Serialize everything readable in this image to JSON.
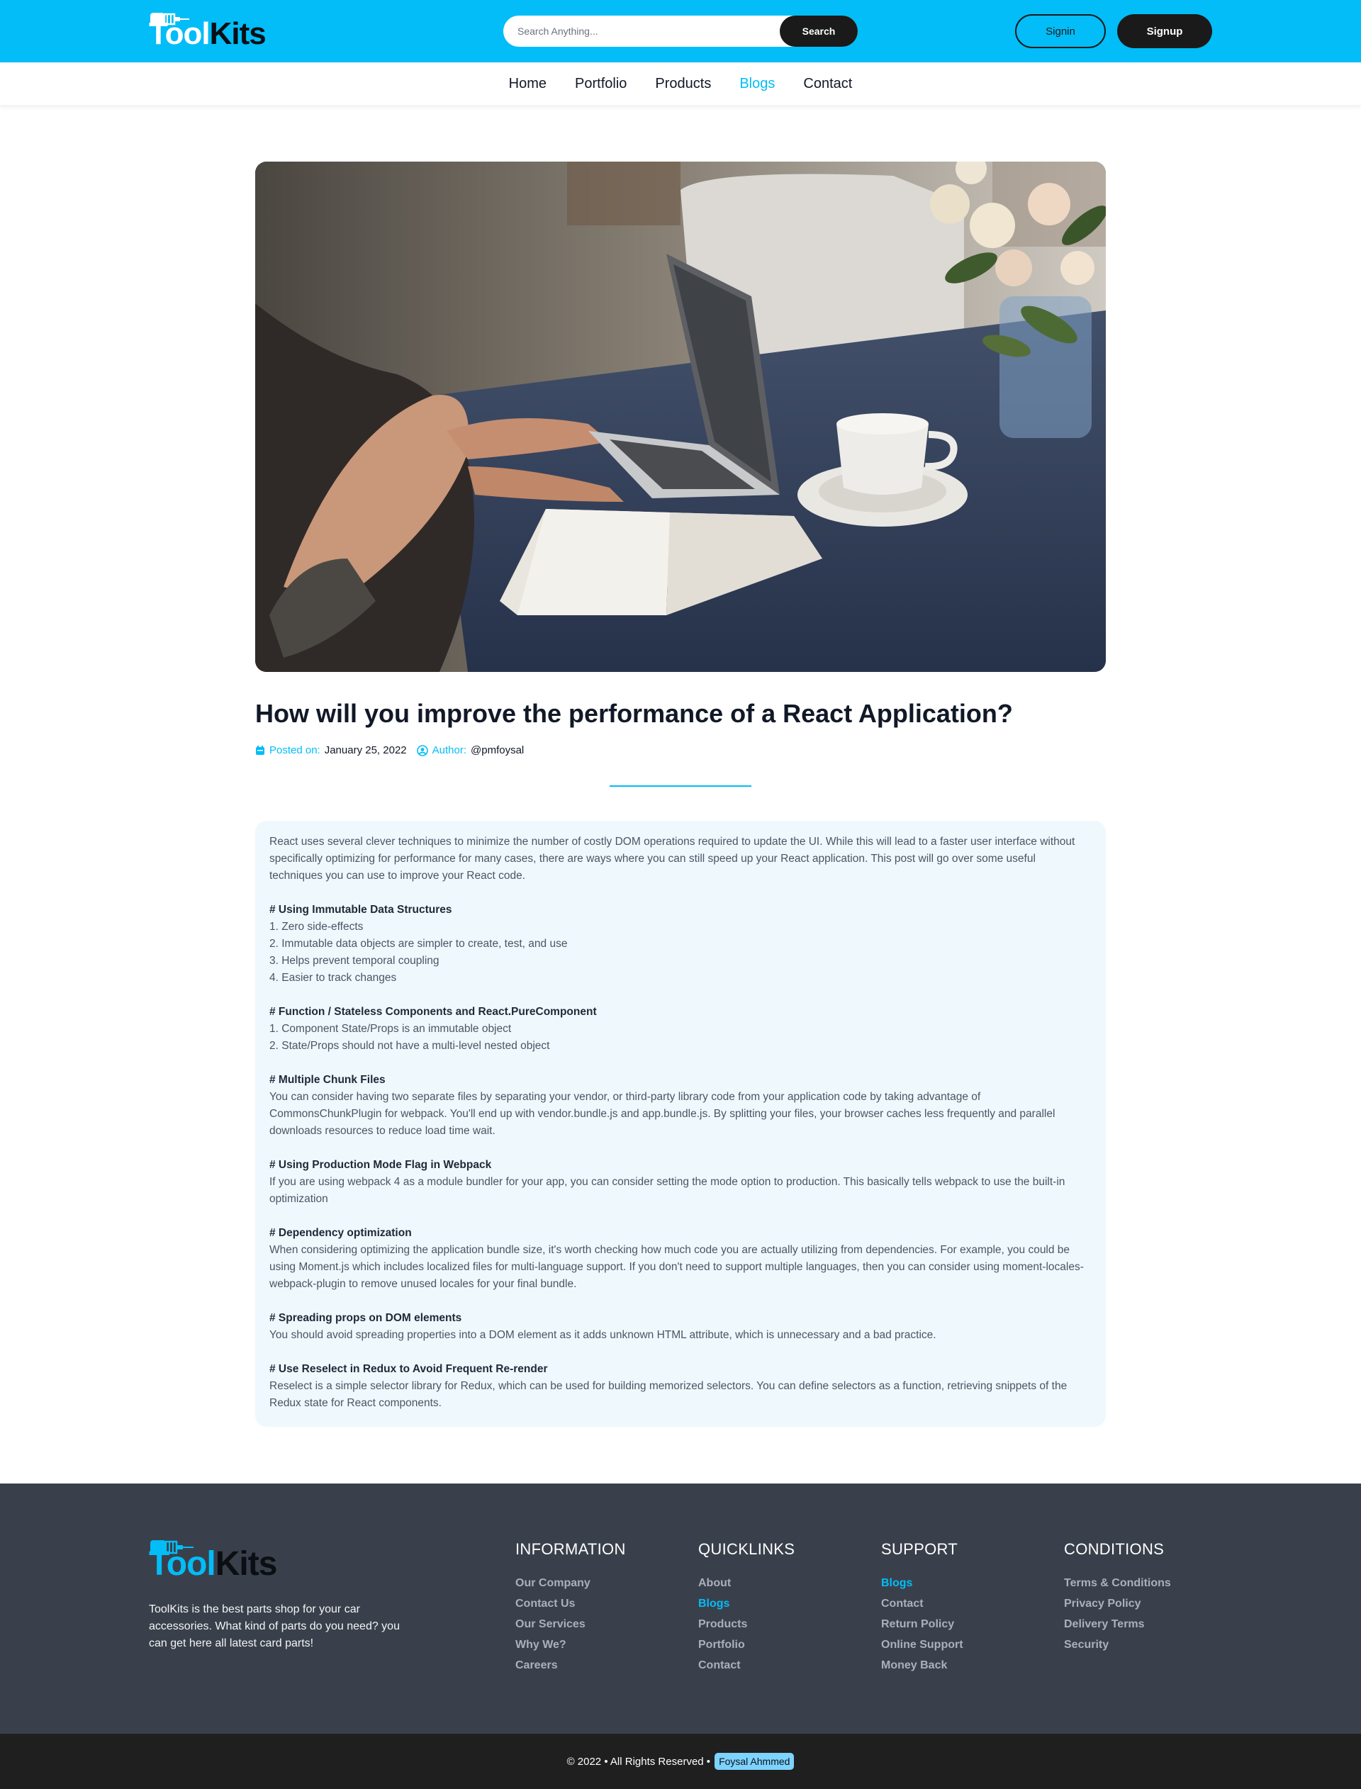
{
  "brand": {
    "logo_first": "Tool",
    "logo_second": "Kits",
    "accent_color": "#02bdf7",
    "dark_color": "#1a1a1a"
  },
  "header": {
    "search_placeholder": "Search Anything...",
    "search_button": "Search",
    "signin": "Signin",
    "signup": "Signup"
  },
  "nav": {
    "items": [
      "Home",
      "Portfolio",
      "Products",
      "Blogs",
      "Contact"
    ],
    "active": "Blogs"
  },
  "article": {
    "title": "How will you improve the performance of a React Application?",
    "posted_label": "Posted on:",
    "posted_date": "January 25, 2022",
    "author_label": "Author:",
    "author": "@pmfoysal",
    "intro": "React uses several clever techniques to minimize the number of costly DOM operations required to update the UI. While this will lead to a faster user interface without specifically optimizing for performance for many cases, there are ways where you can still speed up your React application. This post will go over some useful techniques you can use to improve your React code.",
    "sections": [
      {
        "heading": "# Using Immutable Data Structures",
        "lines": [
          "1. Zero side-effects",
          "2. Immutable data objects are simpler to create, test, and use",
          "3. Helps prevent temporal coupling",
          "4. Easier to track changes"
        ]
      },
      {
        "heading": "# Function / Stateless Components and React.PureComponent",
        "lines": [
          "1. Component State/Props is an immutable object",
          "2. State/Props should not have a multi-level nested object"
        ]
      },
      {
        "heading": "# Multiple Chunk Files",
        "lines": [
          "You can consider having two separate files by separating your vendor, or third-party library code from your application code by taking advantage of CommonsChunkPlugin for webpack. You'll end up with vendor.bundle.js and app.bundle.js. By splitting your files, your browser caches less frequently and parallel downloads resources to reduce load time wait."
        ]
      },
      {
        "heading": "# Using Production Mode Flag in Webpack",
        "lines": [
          "If you are using webpack 4 as a module bundler for your app, you can consider setting the mode option to production. This basically tells webpack to use the built-in optimization"
        ]
      },
      {
        "heading": "# Dependency optimization",
        "lines": [
          "When considering optimizing the application bundle size, it's worth checking how much code you are actually utilizing from dependencies. For example, you could be using Moment.js which includes localized files for multi-language support. If you don't need to support multiple languages, then you can consider using moment-locales-webpack-plugin to remove unused locales for your final bundle."
        ]
      },
      {
        "heading": "# Spreading props on DOM elements",
        "lines": [
          "You should avoid spreading properties into a DOM element as it adds unknown HTML attribute, which is unnecessary and a bad practice."
        ]
      },
      {
        "heading": "# Use Reselect in Redux to Avoid Frequent Re-render",
        "lines": [
          "Reselect is a simple selector library for Redux, which can be used for building memorized selectors. You can define selectors as a function, retrieving snippets of the Redux state for React components."
        ]
      }
    ]
  },
  "footer": {
    "description": "ToolKits is the best parts shop for your car accessories. What kind of parts do you need? you can get here all latest card parts!",
    "columns": [
      {
        "title": "INFORMATION",
        "links": [
          "Our Company",
          "Contact Us",
          "Our Services",
          "Why We?",
          "Careers"
        ],
        "highlight": ""
      },
      {
        "title": "QUICKLINKS",
        "links": [
          "About",
          "Blogs",
          "Products",
          "Portfolio",
          "Contact"
        ],
        "highlight": "Blogs"
      },
      {
        "title": "SUPPORT",
        "links": [
          "Blogs",
          "Contact",
          "Return Policy",
          "Online Support",
          "Money Back"
        ],
        "highlight": "Blogs"
      },
      {
        "title": "CONDITIONS",
        "links": [
          "Terms & Conditions",
          "Privacy Policy",
          "Delivery Terms",
          "Security"
        ],
        "highlight": ""
      }
    ],
    "copyright": "© 2022 • All Rights Reserved •",
    "owner": "Foysal Ahmmed"
  },
  "icons": {
    "posted": "calendar-icon",
    "author": "user-circle-icon",
    "logo": "drill-icon"
  }
}
